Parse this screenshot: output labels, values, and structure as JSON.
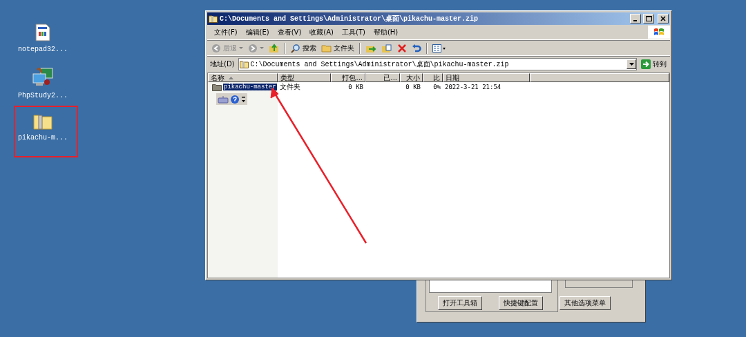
{
  "desktop_icons": [
    {
      "kind": "notepad",
      "label": "notepad32..."
    },
    {
      "kind": "computer",
      "label": "PhpStudy2..."
    },
    {
      "kind": "zip",
      "label": "pikachu-m..."
    }
  ],
  "back_dialog": {
    "buttons": [
      "打开工具箱",
      "快捷键配置",
      "其他选项菜单"
    ]
  },
  "window": {
    "title": "C:\\Documents and Settings\\Administrator\\桌面\\pikachu-master.zip",
    "menu": [
      "文件(F)",
      "编辑(E)",
      "查看(V)",
      "收藏(A)",
      "工具(T)",
      "帮助(H)"
    ],
    "toolbar": [
      {
        "kind": "back",
        "label": "后退",
        "disabled": true
      },
      {
        "kind": "forward",
        "disabled": true
      },
      {
        "kind": "up",
        "disabled": false
      },
      {
        "kind": "search",
        "label": "搜索",
        "disabled": false
      },
      {
        "kind": "folders",
        "label": "文件夹",
        "disabled": false
      },
      {
        "kind": "move"
      },
      {
        "kind": "copy"
      },
      {
        "kind": "delete"
      },
      {
        "kind": "undo"
      },
      {
        "kind": "views"
      }
    ],
    "address": {
      "label": "地址(D)",
      "value": "C:\\Documents and Settings\\Administrator\\桌面\\pikachu-master.zip",
      "go": "转到"
    },
    "columns": [
      "名称",
      "类型",
      "打包...",
      "已...",
      "大小",
      "比",
      "日期"
    ],
    "rows": [
      {
        "cells": [
          "pikachu-master",
          "文件夹",
          "0 KB",
          "",
          "0 KB",
          "0%",
          "2022-3-21 21:54"
        ],
        "selected": true
      }
    ]
  }
}
